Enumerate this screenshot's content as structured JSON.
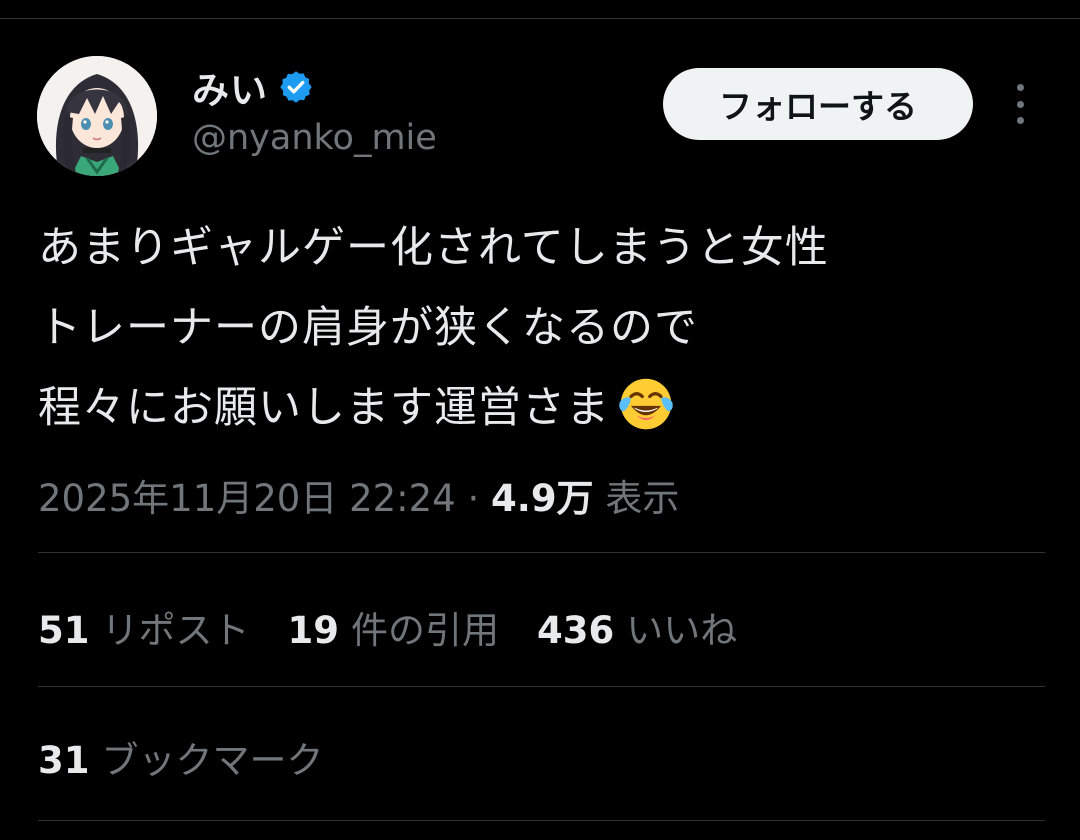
{
  "author": {
    "display_name": "みい",
    "handle": "@nyanko_mie",
    "verified": true
  },
  "follow_button_label": "フォローする",
  "tweet": {
    "lines": [
      "あまりギャルゲー化されてしまうと女性",
      "トレーナーの肩身が狭くなるので",
      "程々にお願いします運営さま"
    ],
    "emoji": "face-with-tears-of-joy"
  },
  "meta": {
    "timestamp": "2025年11月20日 22:24",
    "separator": "·",
    "views_count": "4.9万",
    "views_label": "表示"
  },
  "stats": {
    "reposts": {
      "count": "51",
      "label": "リポスト"
    },
    "quotes": {
      "count": "19",
      "label": "件の引用"
    },
    "likes": {
      "count": "436",
      "label": "いいね"
    },
    "bookmarks": {
      "count": "31",
      "label": "ブックマーク"
    }
  },
  "colors": {
    "background": "#000000",
    "primary_text": "#e7e9ea",
    "secondary_text": "#71767b",
    "divider": "#2f3336",
    "verified_badge": "#1d9bf0",
    "follow_button_bg": "#eff3f4"
  }
}
